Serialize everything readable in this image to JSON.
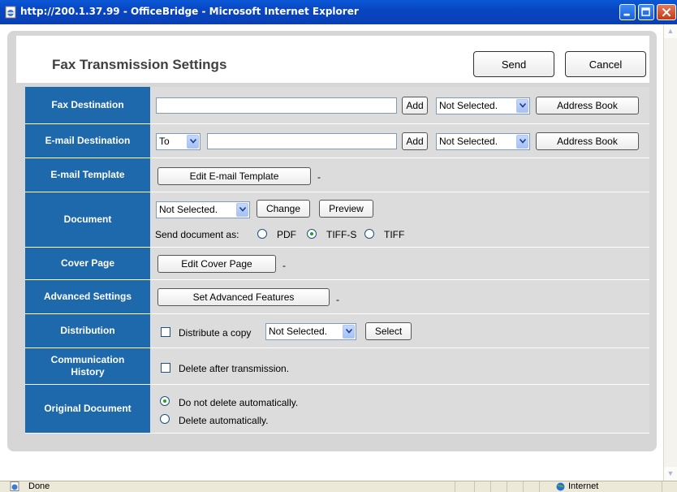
{
  "window": {
    "title": "http://200.1.37.99 - OfficeBridge - Microsoft Internet Explorer"
  },
  "header": {
    "title": "Fax Transmission Settings",
    "send_label": "Send",
    "cancel_label": "Cancel"
  },
  "rows": {
    "fax": {
      "label": "Fax Destination",
      "input_value": "",
      "add_label": "Add",
      "select_value": "Not Selected.",
      "address_book_label": "Address Book"
    },
    "email": {
      "label": "E-mail Destination",
      "to_value": "To",
      "input_value": "",
      "add_label": "Add",
      "select_value": "Not Selected.",
      "address_book_label": "Address Book"
    },
    "template": {
      "label": "E-mail Template",
      "button_label": "Edit E-mail Template",
      "dash": "-"
    },
    "document": {
      "label": "Document",
      "select_value": "Not Selected.",
      "change_label": "Change",
      "preview_label": "Preview",
      "send_as_label": "Send document as:",
      "options": [
        "PDF",
        "TIFF-S",
        "TIFF"
      ],
      "selected": "TIFF-S"
    },
    "cover": {
      "label": "Cover Page",
      "button_label": "Edit Cover Page",
      "dash": "-"
    },
    "advanced": {
      "label": "Advanced Settings",
      "button_label": "Set Advanced Features",
      "dash": "-"
    },
    "distribution": {
      "label": "Distribution",
      "checkbox_label": "Distribute a copy",
      "checked": false,
      "select_value": "Not Selected.",
      "select_label": "Select"
    },
    "history": {
      "label": "Communication History",
      "checkbox_label": "Delete after transmission.",
      "checked": false
    },
    "original": {
      "label": "Original Document",
      "option1": "Do not delete automatically.",
      "option2": "Delete automatically.",
      "selected": "Do not delete automatically."
    }
  },
  "status": {
    "text": "Done",
    "zone": "Internet"
  }
}
